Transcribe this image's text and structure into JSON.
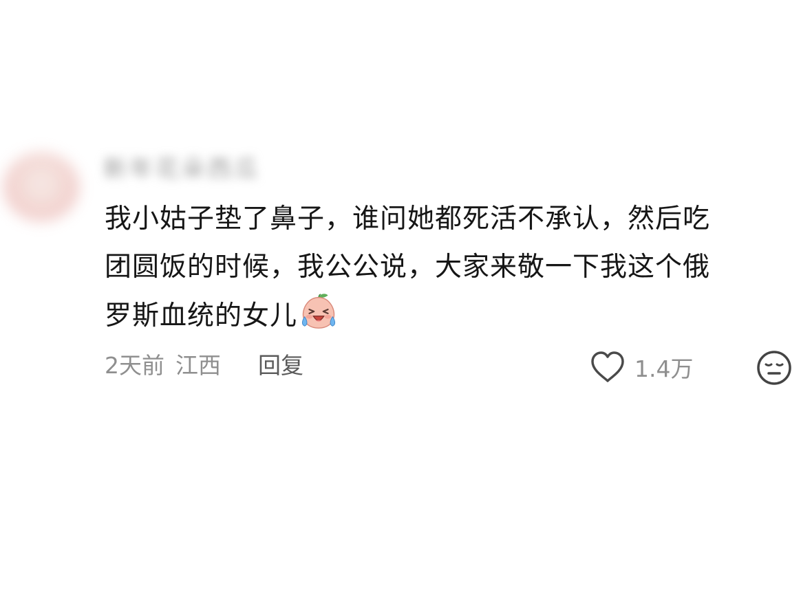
{
  "comment": {
    "username": "新年花朵西瓜",
    "text_lines": [
      "我小姑子垫了鼻子，谁问她都死活不承认，然后吃",
      "团圆饭的时候，我公公说，大家来敬一下我这个俄",
      "罗斯血统的女儿"
    ],
    "emoji": "crying-laughing-peach-emoji",
    "time": "2天前",
    "region": "江西",
    "reply_label": "回复",
    "like_count": "1.4万",
    "like_icon": "heart-outline-icon",
    "dislike_icon": "neutral-face-icon"
  },
  "colors": {
    "text": "#161616",
    "meta": "#8f8f8f",
    "reply": "#5a5a5a",
    "icon": "#444444"
  }
}
